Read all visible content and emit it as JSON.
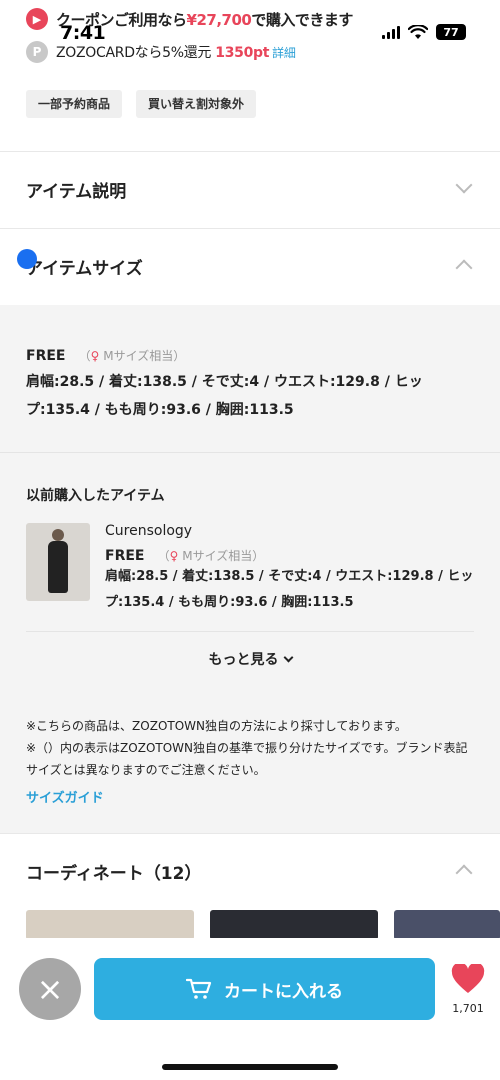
{
  "status": {
    "time": "7:41",
    "battery": "77"
  },
  "coupon": {
    "icon": "coupon-icon",
    "prefix": "クーポンご利用なら",
    "amount": "¥27,700",
    "suffix": "で購入できます"
  },
  "zozocard": {
    "icon_letter": "P",
    "prefix": "ZOZOCARDなら5%還元 ",
    "points": "1350pt",
    "detail": "詳細"
  },
  "tags": [
    "一部予約商品",
    "買い替え割対象外"
  ],
  "sections": {
    "item_description": "アイテム説明",
    "item_size": "アイテムサイズ",
    "coordinate": "コーディネート（12）"
  },
  "size": {
    "label": "FREE",
    "equiv_prefix": "（",
    "equiv": "Mサイズ相当）",
    "measurements": "肩幅:28.5 / 着丈:138.5 / そで丈:4 / ウエスト:129.8 / ヒップ:135.4 / もも周り:93.6 / 胸囲:113.5"
  },
  "previous": {
    "title": "以前購入したアイテム",
    "brand": "Curensology",
    "label": "FREE",
    "equiv_prefix": "（",
    "equiv": "Mサイズ相当）",
    "measurements": "肩幅:28.5 / 着丈:138.5 / そで丈:4 / ウエスト:129.8 / ヒップ:135.4 / もも周り:93.6 / 胸囲:113.5"
  },
  "more": "もっと見る",
  "notes": [
    "※こちらの商品は、ZOZOTOWN独自の方法により採寸しております。",
    "※（）内の表示はZOZOTOWN独自の基準で振り分けたサイズです。ブランド表記サイズとは異なりますのでご注意ください。"
  ],
  "size_guide": "サイズガイド",
  "bottom": {
    "cart_label": "カートに入れる",
    "fav_count": "1,701"
  },
  "colors": {
    "accent": "#2eaee0",
    "red": "#e8455a",
    "link": "#2a9fd6"
  }
}
